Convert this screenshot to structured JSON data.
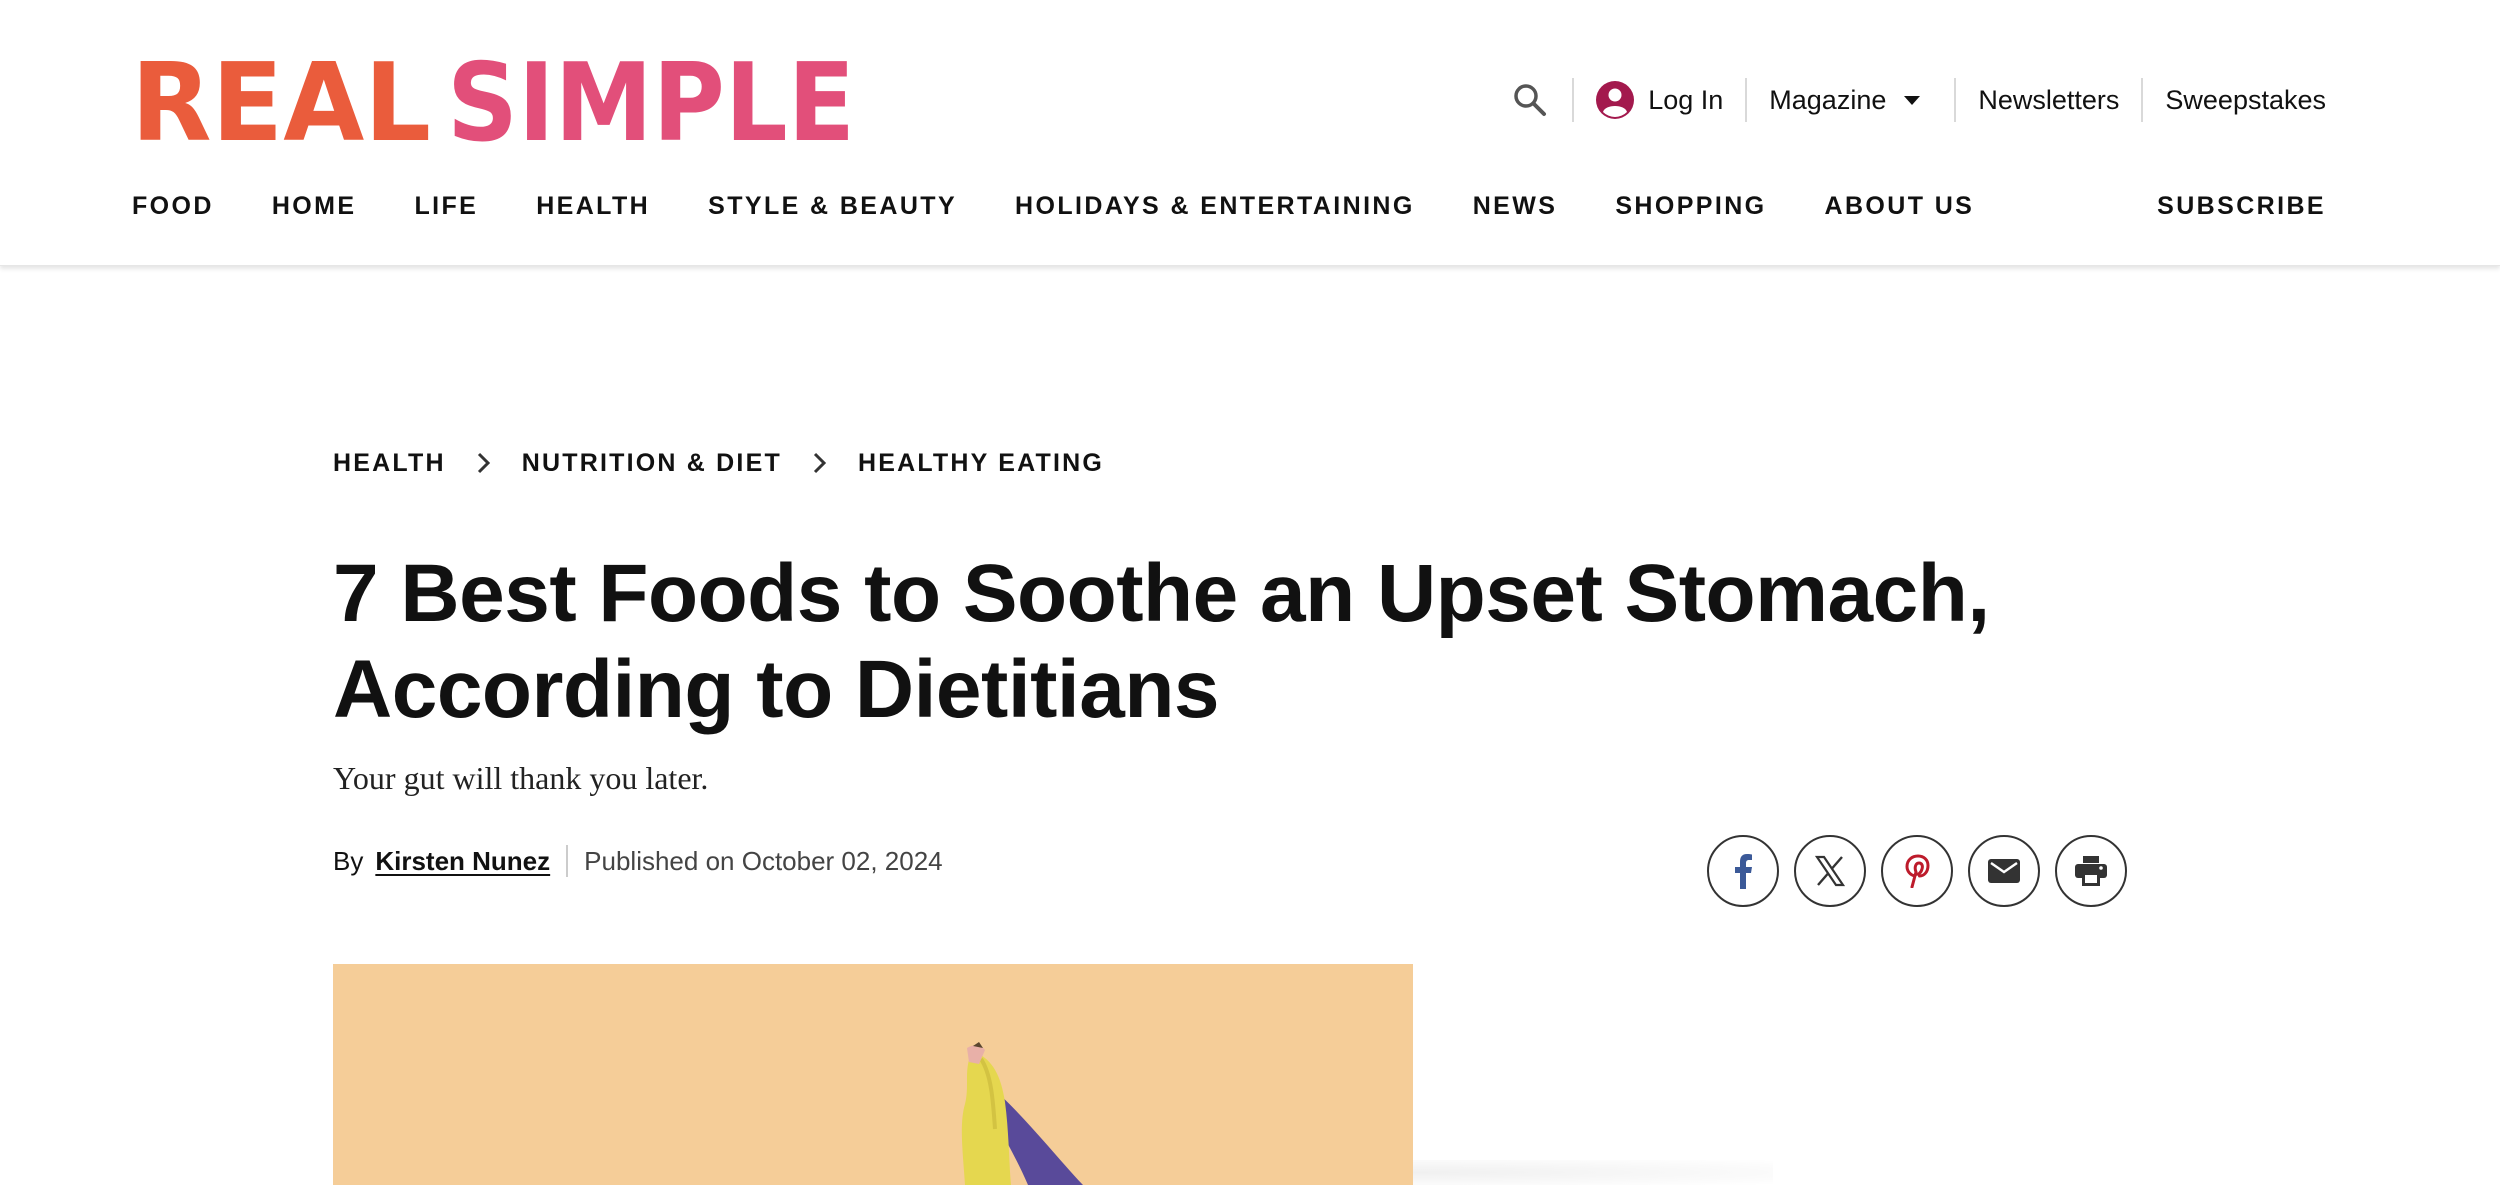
{
  "brand": {
    "logo_word_1": "REAL",
    "logo_word_2": "SIMPLE",
    "color_real": "#ea5c3c",
    "color_simple": "#e24f7a"
  },
  "utility": {
    "search_icon": "search-icon",
    "login_label": "Log In",
    "magazine_label": "Magazine",
    "newsletters_label": "Newsletters",
    "sweepstakes_label": "Sweepstakes"
  },
  "nav": {
    "items": [
      "FOOD",
      "HOME",
      "LIFE",
      "HEALTH",
      "STYLE & BEAUTY",
      "HOLIDAYS & ENTERTAINING",
      "NEWS",
      "SHOPPING",
      "ABOUT US"
    ],
    "subscribe": "SUBSCRIBE"
  },
  "breadcrumb": [
    "HEALTH",
    "NUTRITION & DIET",
    "HEALTHY EATING"
  ],
  "article": {
    "title": "7 Best Foods to Soothe an Upset Stomach, According to Dietitians",
    "dek": "Your gut will thank you later.",
    "by": "By",
    "author": "Kirsten Nunez",
    "published": "Published on October 02, 2024"
  },
  "share": {
    "icons": [
      "facebook-icon",
      "x-icon",
      "pinterest-icon",
      "email-icon",
      "print-icon"
    ]
  },
  "colors": {
    "facebook": "#3b5998",
    "pinterest": "#bd1b2b",
    "login_avatar": "#a3194d",
    "hero_bg": "#f5cd98"
  }
}
